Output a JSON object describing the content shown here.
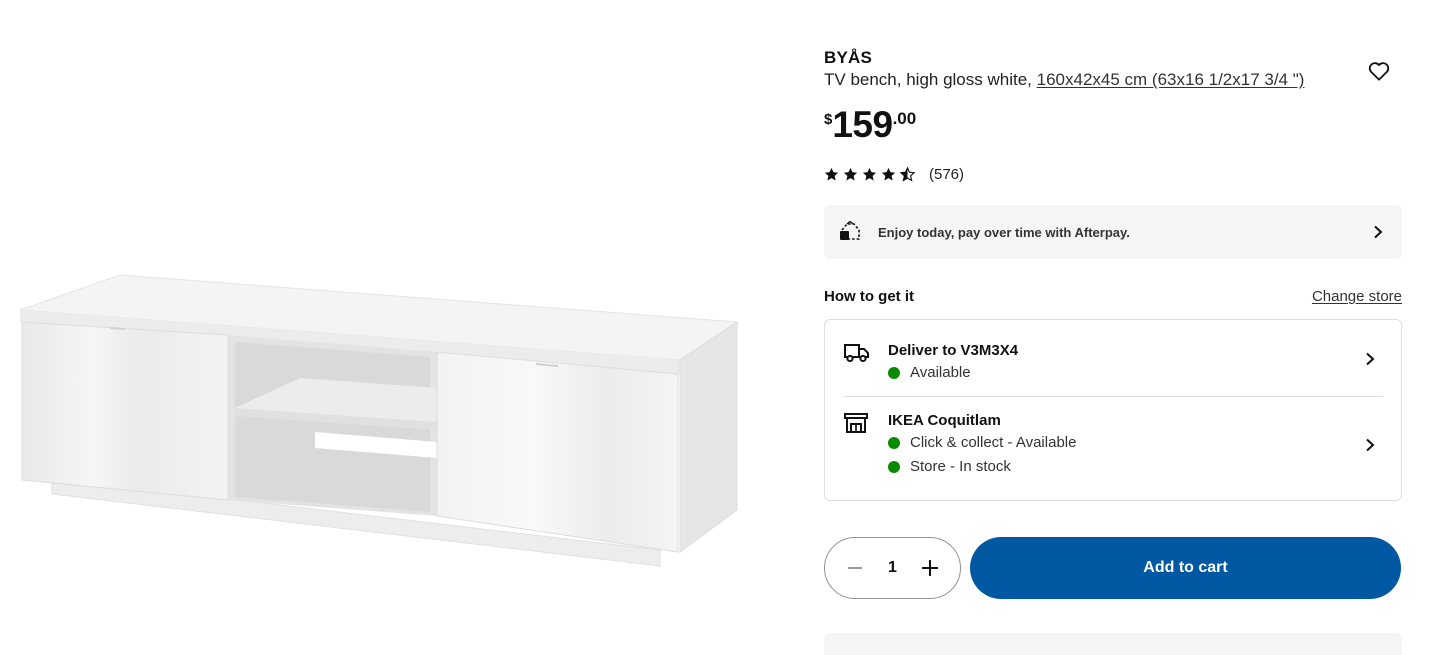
{
  "product": {
    "name": "BYÅS",
    "description": "TV bench, high gloss white, ",
    "measurements": "160x42x45 cm (63x16 1/2x17 3/4 \")"
  },
  "price": {
    "currency": "$",
    "integer": "159",
    "decimal": ".00"
  },
  "rating": {
    "stars": 4.5,
    "max_stars": 5,
    "count_label": "(576)"
  },
  "afterpay": {
    "text": "Enjoy today, pay over time with Afterpay.",
    "icon": "afterpay-icon"
  },
  "how_to_get": {
    "title": "How to get it",
    "change_store": "Change store",
    "delivery": {
      "title": "Deliver to V3M3X4",
      "status": "Available",
      "icon": "truck-icon"
    },
    "store": {
      "title": "IKEA Coquitlam",
      "statuses": [
        "Click & collect - Available",
        "Store - In stock"
      ],
      "icon": "store-icon"
    }
  },
  "cart": {
    "quantity": "1",
    "add_label": "Add to cart"
  },
  "colors": {
    "accent": "#0058a3",
    "available": "#0a8a00",
    "panel": "#f5f5f5"
  }
}
